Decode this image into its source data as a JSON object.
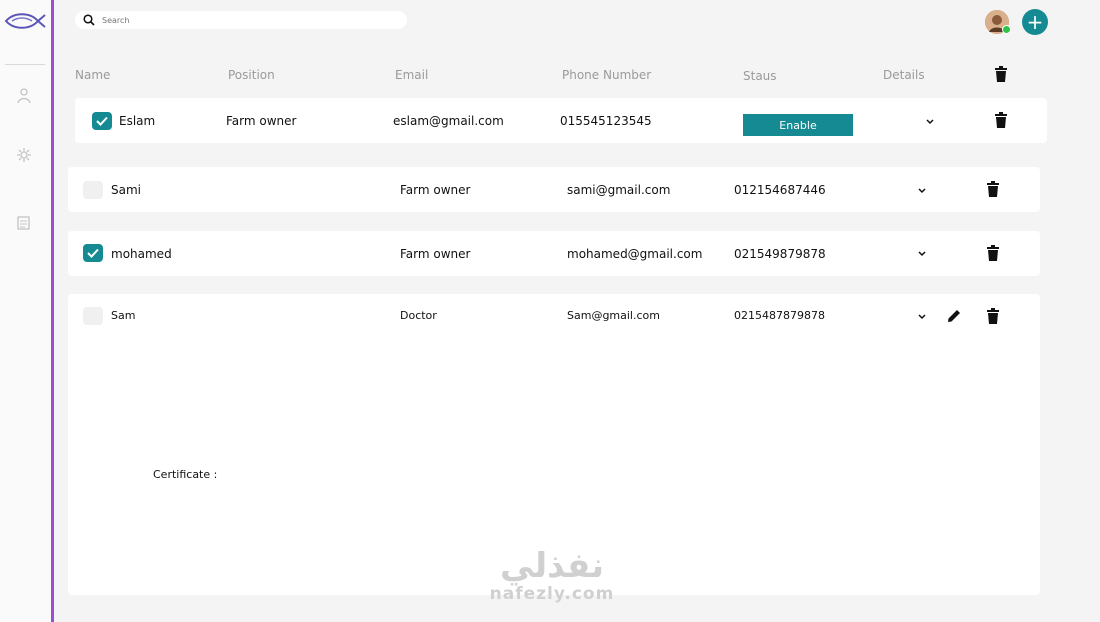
{
  "search": {
    "placeholder": "Search"
  },
  "header": {
    "columns": [
      "Name",
      "Position",
      "Email",
      "Phone Number",
      "Staus",
      "Details"
    ]
  },
  "rows": [
    {
      "name": "Eslam",
      "position": "Farm owner",
      "email": "eslam@gmail.com",
      "phone": "015545123545",
      "status": "Enable",
      "checked": true
    },
    {
      "name": "Sami",
      "position": "Farm owner",
      "email": "sami@gmail.com",
      "phone": "012154687446",
      "checked": false
    },
    {
      "name": "mohamed",
      "position": "Farm owner",
      "email": "mohamed@gmail.com",
      "phone": "021549879878",
      "checked": true
    },
    {
      "name": "Sam",
      "position": "Doctor",
      "email": "Sam@gmail.com",
      "phone": "0215487879878",
      "checked": false
    }
  ],
  "details": {
    "certificate_label": "Certificate :"
  },
  "watermark": {
    "arabic": "نفذلي",
    "latin": "nafezly.com"
  },
  "colors": {
    "accent": "#158a92",
    "sidebar_border": "#9b4dd6",
    "online": "#2ec24a"
  },
  "icons": {
    "logo": "fish-logo-icon",
    "user": "user-icon",
    "settings": "gear-icon",
    "reports": "document-icon",
    "search": "search-icon",
    "add": "plus-icon",
    "delete": "trash-icon",
    "edit": "pencil-icon",
    "expand": "chevron-down-icon"
  }
}
